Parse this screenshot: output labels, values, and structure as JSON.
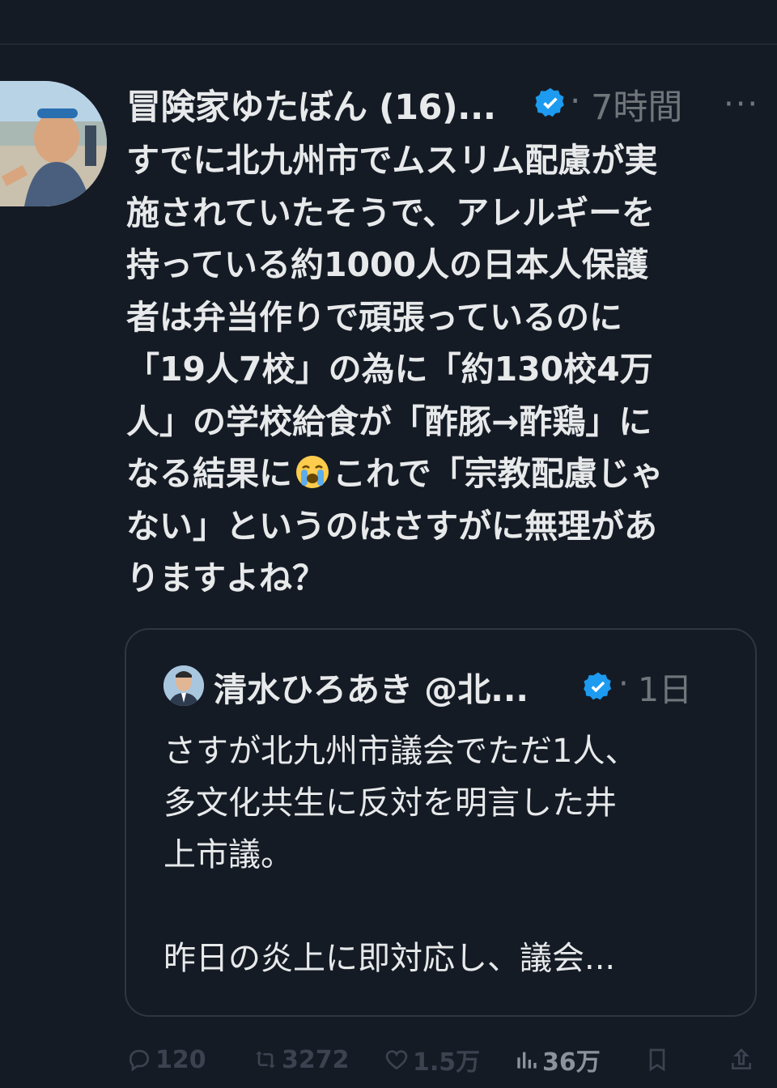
{
  "tweet": {
    "author": "冒険家ゆたぼん (16)...",
    "separator": "·",
    "time": "7時間",
    "more_label": "···",
    "text_part1": "すでに北九州市でムスリム配慮が実\n施されていたそうで、アレルギーを\n持っている約1000人の日本人保護\n者は弁当作りで頑張っているのに\n「19人7校」の為に「約130校4万\n人」の学校給食が「酢豚→酢鶏」に\nなる結果に",
    "emoji_name": "loudly-crying-face-emoji",
    "text_part2": "これで「宗教配慮じゃ\nない」というのはさすがに無理があ\nりますよね？"
  },
  "quote": {
    "author": "清水ひろあき @北...",
    "separator": "·",
    "time": "1日",
    "text": "さすが北九州市議会でただ1人、\n多文化共生に反対を明言した井\n上市議。\n\n昨日の炎上に即対応し、議会..."
  },
  "actions": {
    "replies": "120",
    "reposts": "3272",
    "likes": "1.5万",
    "views": "36万"
  },
  "colors": {
    "background": "#151b25",
    "text": "#e7e9ea",
    "muted": "#71767b",
    "verified": "#1d9bf0"
  }
}
